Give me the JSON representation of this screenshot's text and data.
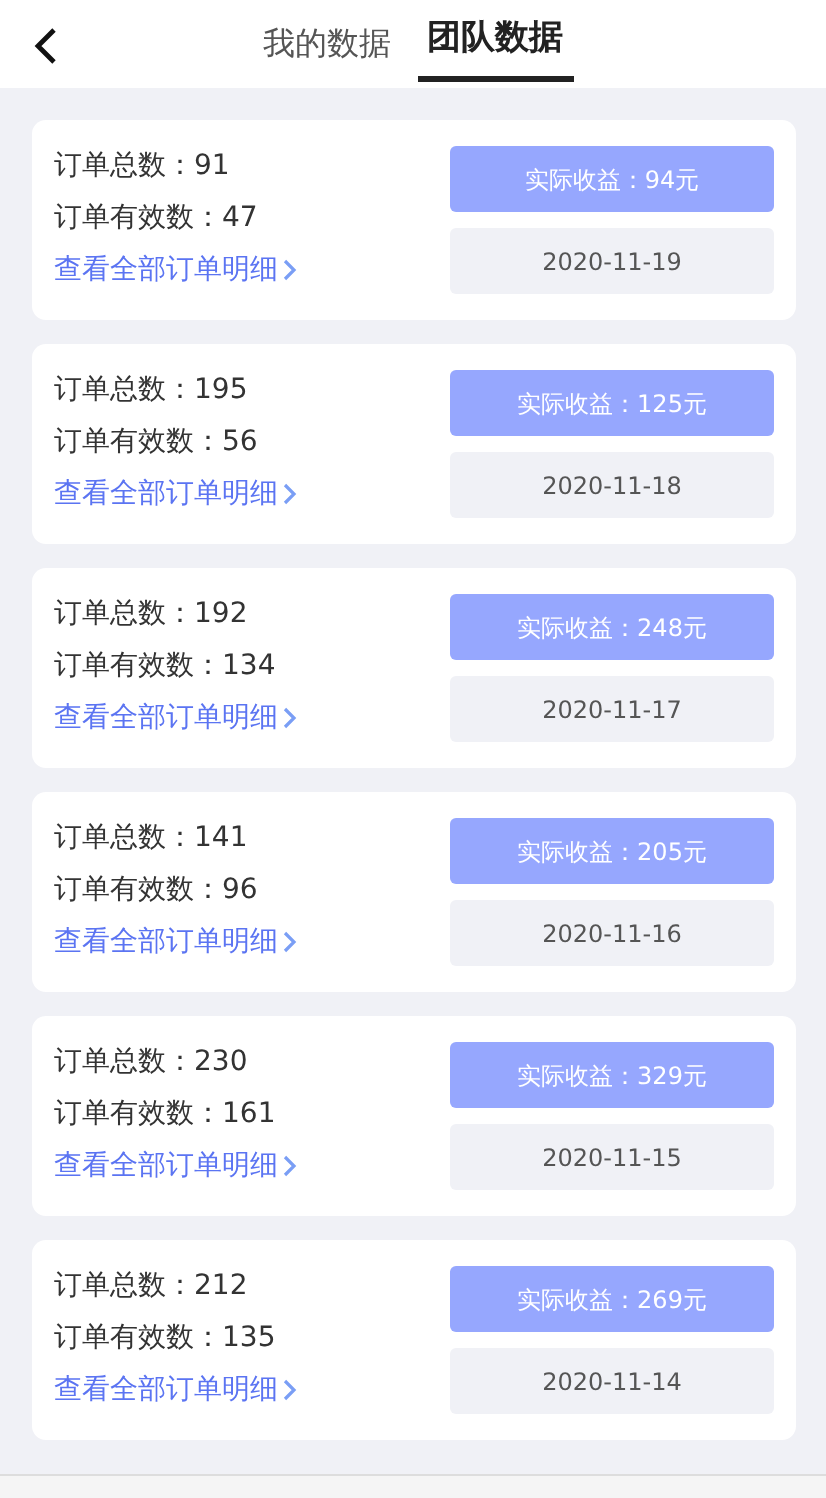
{
  "tabs": [
    {
      "label": "我的数据",
      "selected": false
    },
    {
      "label": "团队数据",
      "selected": true
    }
  ],
  "cards": [
    {
      "total": "订单总数：91",
      "valid": "订单有效数：47",
      "link": "查看全部订单明细",
      "earnings": "实际收益：94元",
      "date": "2020-11-19"
    },
    {
      "total": "订单总数：195",
      "valid": "订单有效数：56",
      "link": "查看全部订单明细",
      "earnings": "实际收益：125元",
      "date": "2020-11-18"
    },
    {
      "total": "订单总数：192",
      "valid": "订单有效数：134",
      "link": "查看全部订单明细",
      "earnings": "实际收益：248元",
      "date": "2020-11-17"
    },
    {
      "total": "订单总数：141",
      "valid": "订单有效数：96",
      "link": "查看全部订单明细",
      "earnings": "实际收益：205元",
      "date": "2020-11-16"
    },
    {
      "total": "订单总数：230",
      "valid": "订单有效数：161",
      "link": "查看全部订单明细",
      "earnings": "实际收益：329元",
      "date": "2020-11-15"
    },
    {
      "total": "订单总数：212",
      "valid": "订单有效数：135",
      "link": "查看全部订单明细",
      "earnings": "实际收益：269元",
      "date": "2020-11-14"
    }
  ]
}
